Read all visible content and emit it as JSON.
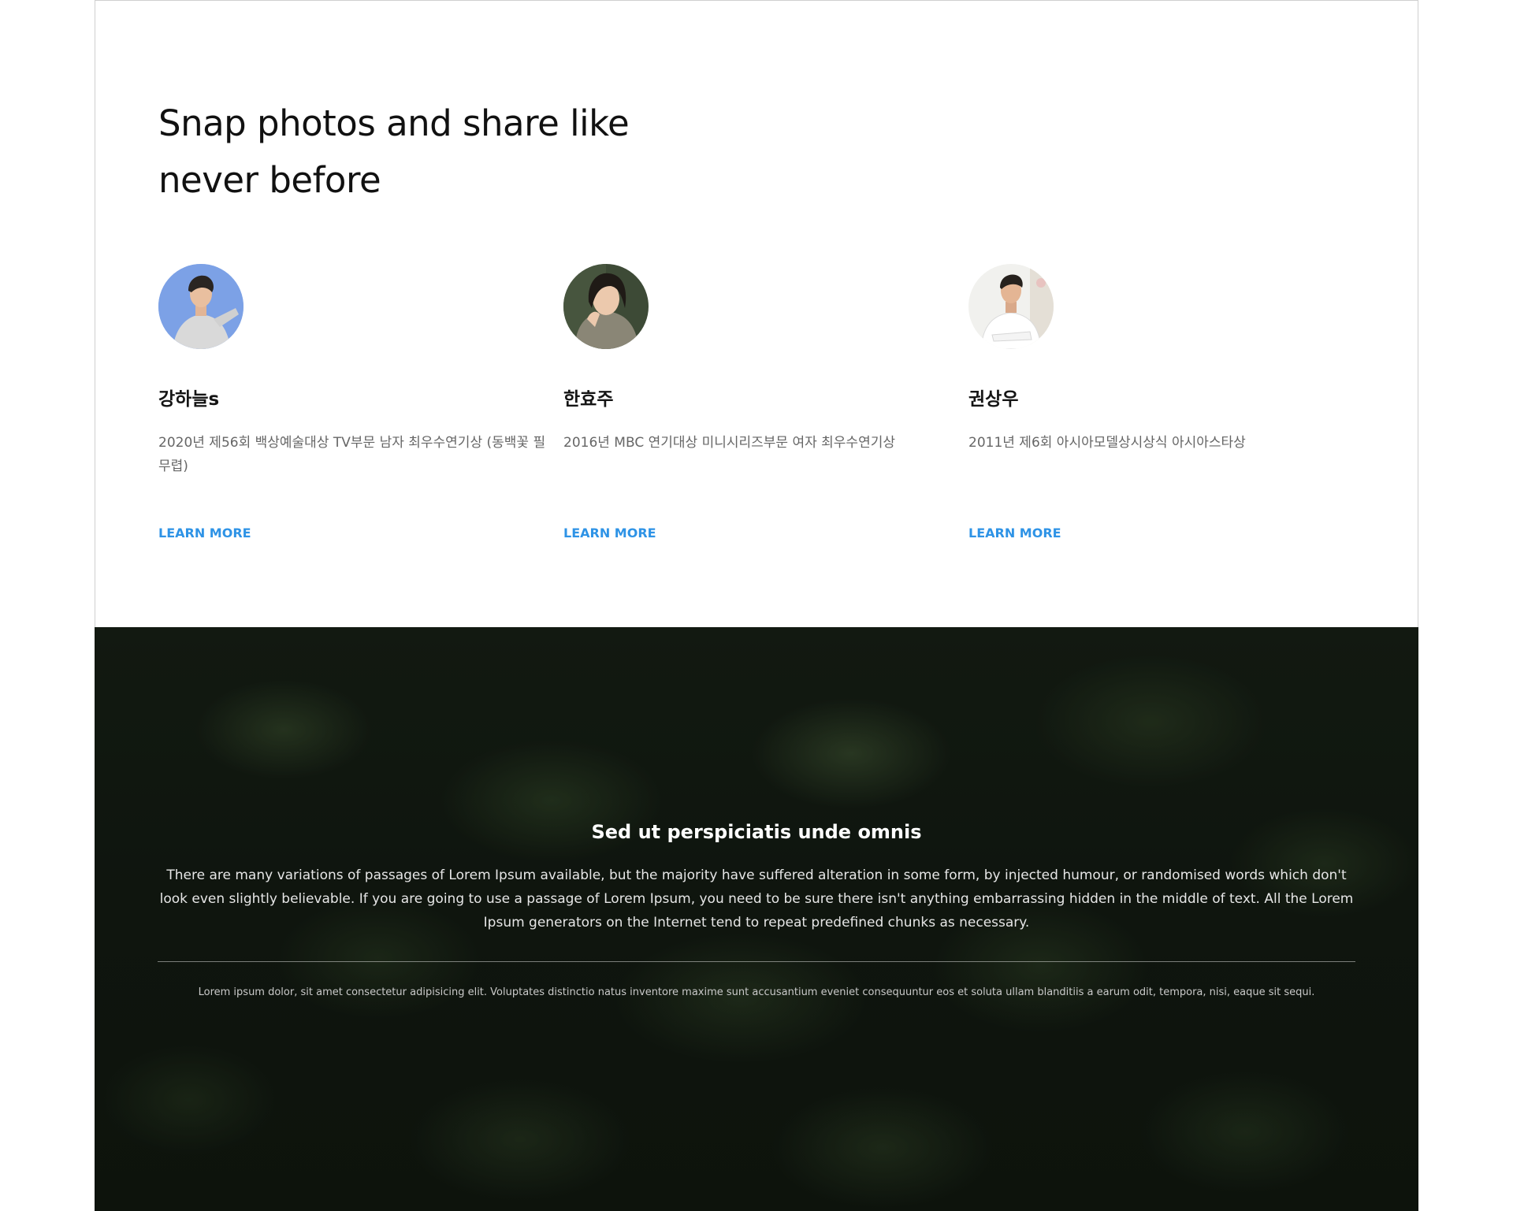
{
  "section": {
    "heading_line1": "Snap photos and share like",
    "heading_line2": "never before"
  },
  "profiles": [
    {
      "name": "강하늘s",
      "description": "2020년 제56회 백상예술대상 TV부문 남자 최우수연기상 (동백꽃 필 무렵)",
      "link_label": "LEARN MORE"
    },
    {
      "name": "한효주",
      "description": "2016년 MBC 연기대상 미니시리즈부문 여자 최우수연기상",
      "link_label": "LEARN MORE"
    },
    {
      "name": "권상우",
      "description": "2011년 제6회 아시아모델상시상식 아시아스타상",
      "link_label": "LEARN MORE"
    }
  ],
  "banner": {
    "title": "Sed ut perspiciatis unde omnis",
    "text": "There are many variations of passages of Lorem Ipsum available, but the majority have suffered alteration in some form, by injected humour, or randomised words which don't look even slightly believable. If you are going to use a passage of Lorem Ipsum, you need to be sure there isn't anything embarrassing hidden in the middle of text. All the Lorem Ipsum generators on the Internet tend to repeat predefined chunks as necessary.",
    "footnote": "Lorem ipsum dolor, sit amet consectetur adipisicing elit. Voluptates distinctio natus inventore maxime sunt accusantium eveniet consequuntur eos et soluta ullam blanditiis a earum odit, tempora, nisi, eaque sit sequi."
  },
  "colors": {
    "link": "#2e93e6",
    "heading": "#111111",
    "body_text": "#666666",
    "banner_background": "#141c13"
  },
  "icons": [
    "avatar-photo-1",
    "avatar-photo-2",
    "avatar-photo-3"
  ]
}
